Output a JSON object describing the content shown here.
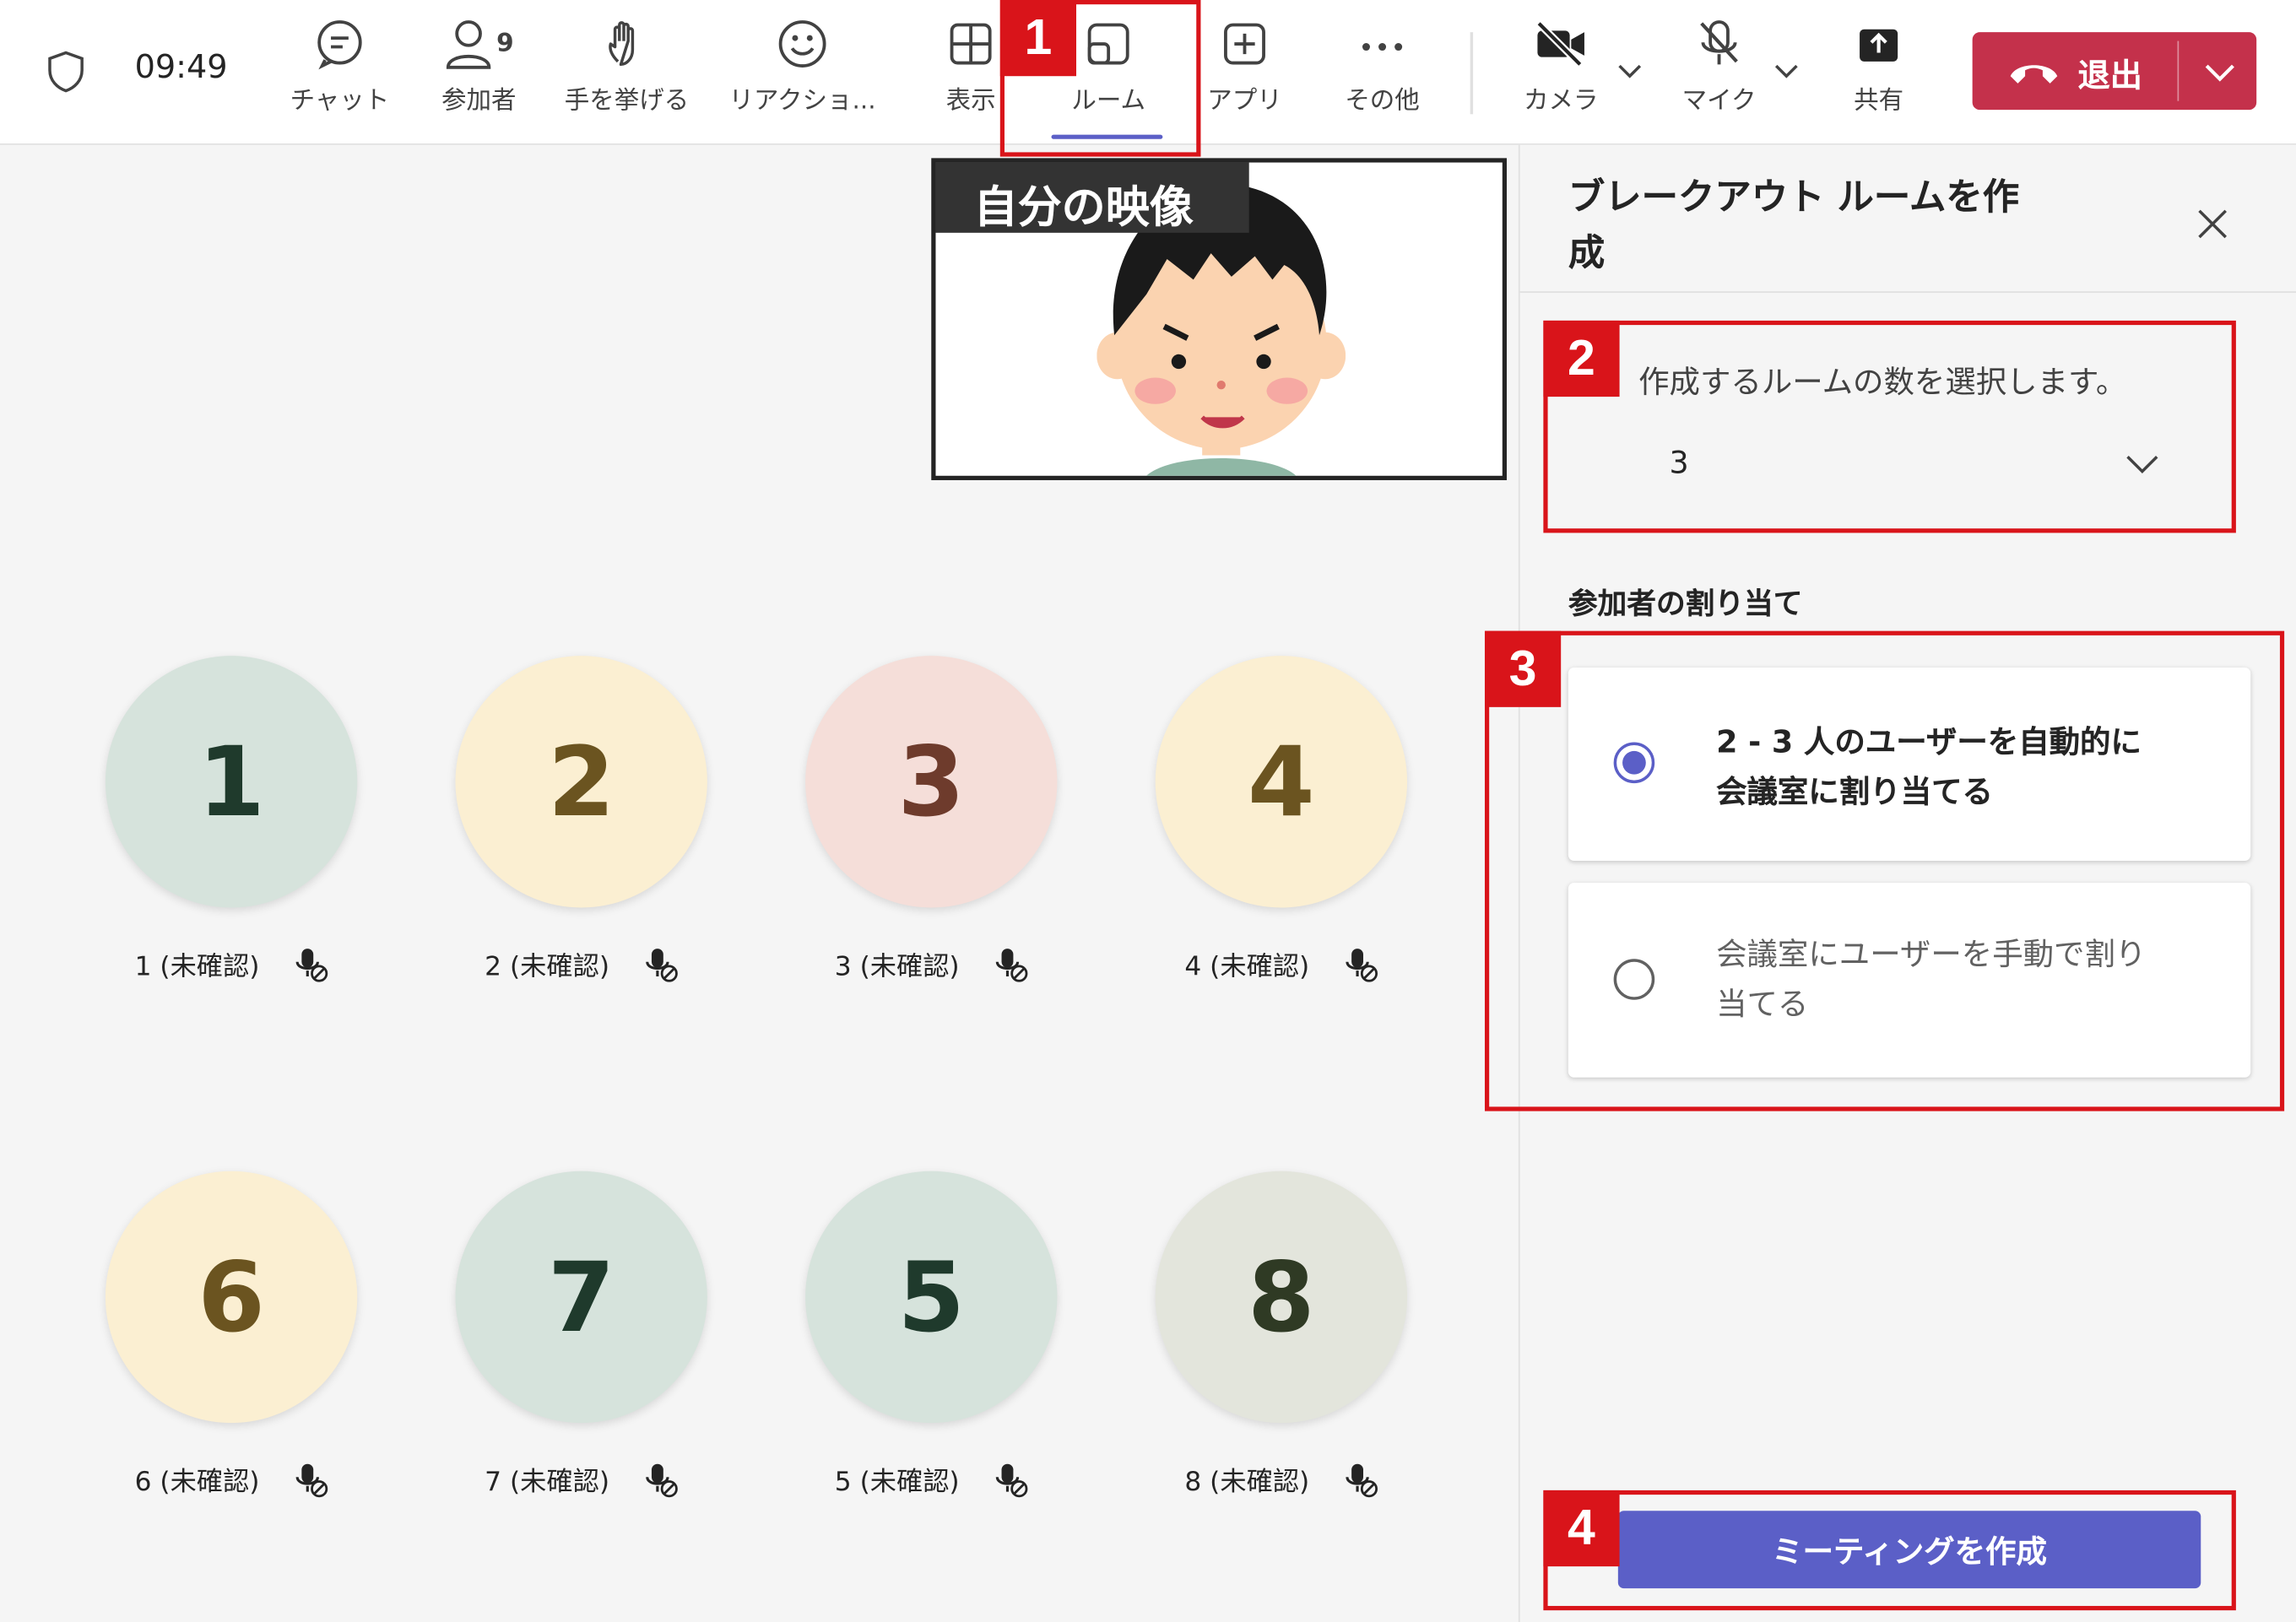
{
  "topbar": {
    "time": "09:49",
    "participant_count": "9",
    "buttons": {
      "chat": "チャット",
      "people": "参加者",
      "raise_hand": "手を挙げる",
      "reactions": "リアクショ...",
      "view": "表示",
      "rooms": "ルーム",
      "apps": "アプリ",
      "more": "その他",
      "camera": "カメラ",
      "mic": "マイク",
      "share": "共有"
    },
    "leave_label": "退出"
  },
  "self_video": {
    "label": "自分の映像"
  },
  "rooms": [
    {
      "number": "1",
      "label": "1 (未確認)",
      "bg": "#d6e3dc",
      "fg": "#1f3a2c"
    },
    {
      "number": "2",
      "label": "2 (未確認)",
      "bg": "#fbefd2",
      "fg": "#6b5420"
    },
    {
      "number": "3",
      "label": "3 (未確認)",
      "bg": "#f5ded9",
      "fg": "#6e3b2c"
    },
    {
      "number": "4",
      "label": "4 (未確認)",
      "bg": "#fbefd2",
      "fg": "#6b5420"
    },
    {
      "number": "6",
      "label": "6 (未確認)",
      "bg": "#fbefd2",
      "fg": "#6b5420"
    },
    {
      "number": "7",
      "label": "7 (未確認)",
      "bg": "#d6e3dc",
      "fg": "#1f3a2c"
    },
    {
      "number": "5",
      "label": "5 (未確認)",
      "bg": "#d6e3dc",
      "fg": "#1f3a2c"
    },
    {
      "number": "8",
      "label": "8 (未確認)",
      "bg": "#e3e5dc",
      "fg": "#2f3a24"
    }
  ],
  "panel": {
    "title_line1": "ブレークアウト ルームを作",
    "title_line2": "成",
    "room_count_label": "作成するルームの数を選択します。",
    "room_count_value": "3",
    "assignment_heading": "参加者の割り当て",
    "option_auto_line1": "2 - 3 人のユーザーを自動的に",
    "option_auto_line2": "会議室に割り当てる",
    "option_manual_line1": "会議室にユーザーを手動で割り",
    "option_manual_line2": "当てる",
    "selected_option": "auto",
    "create_button": "ミーティングを作成"
  },
  "annotations": {
    "n1": "1",
    "n2": "2",
    "n3": "3",
    "n4": "4"
  },
  "colors": {
    "accent": "#5b5fc7",
    "leave": "#c4314b",
    "annotation": "#d9141a"
  }
}
